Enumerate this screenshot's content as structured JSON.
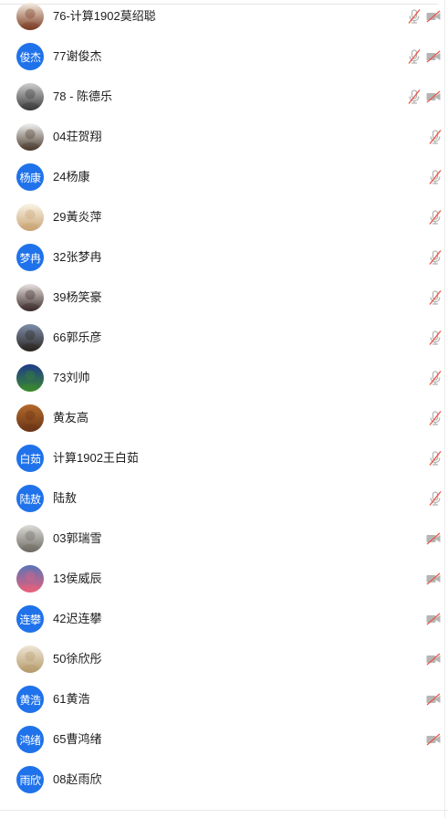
{
  "participants": [
    {
      "name": "76-计算1902莫绍聪",
      "avatar": {
        "kind": "photo",
        "colors": [
          "#f7eee3",
          "#7a3b21"
        ]
      },
      "mic": "muted",
      "camera": "off"
    },
    {
      "name": "77谢俊杰",
      "avatar": {
        "kind": "text",
        "text": "俊杰"
      },
      "mic": "muted",
      "camera": "off"
    },
    {
      "name": "78 - 陈德乐",
      "avatar": {
        "kind": "photo",
        "colors": [
          "#cfcfcf",
          "#3a3a3a"
        ]
      },
      "mic": "muted",
      "camera": "off"
    },
    {
      "name": "04荘贺翔",
      "avatar": {
        "kind": "photo",
        "colors": [
          "#f4f4f4",
          "#4b3a2c"
        ]
      },
      "mic": "muted",
      "camera": "none"
    },
    {
      "name": "24杨康",
      "avatar": {
        "kind": "text",
        "text": "杨康"
      },
      "mic": "muted",
      "camera": "none"
    },
    {
      "name": "29黃炎萍",
      "avatar": {
        "kind": "photo",
        "colors": [
          "#fbf4e6",
          "#c8a373"
        ]
      },
      "mic": "muted",
      "camera": "none"
    },
    {
      "name": "32张梦冉",
      "avatar": {
        "kind": "text",
        "text": "梦冉"
      },
      "mic": "muted",
      "camera": "none"
    },
    {
      "name": "39杨笑豪",
      "avatar": {
        "kind": "photo",
        "colors": [
          "#e9e2e0",
          "#3b2c2a"
        ]
      },
      "mic": "muted",
      "camera": "none"
    },
    {
      "name": "66郭乐彦",
      "avatar": {
        "kind": "photo",
        "colors": [
          "#7e8fab",
          "#2b2520"
        ]
      },
      "mic": "muted",
      "camera": "none"
    },
    {
      "name": "73刘帅",
      "avatar": {
        "kind": "photo",
        "colors": [
          "#1e3b8a",
          "#3b8a2d"
        ]
      },
      "mic": "muted",
      "camera": "none"
    },
    {
      "name": "黄友高",
      "avatar": {
        "kind": "photo",
        "colors": [
          "#b36a2b",
          "#6a3516"
        ]
      },
      "mic": "muted",
      "camera": "none"
    },
    {
      "name": "计算1902王白茹",
      "avatar": {
        "kind": "text",
        "text": "白茹"
      },
      "mic": "muted",
      "camera": "none"
    },
    {
      "name": "陆敖",
      "avatar": {
        "kind": "text",
        "text": "陆敖"
      },
      "mic": "muted",
      "camera": "none"
    },
    {
      "name": "03郭瑞雪",
      "avatar": {
        "kind": "photo",
        "colors": [
          "#dcdcd8",
          "#6e6a63"
        ]
      },
      "mic": "none",
      "camera": "off"
    },
    {
      "name": "13侯威辰",
      "avatar": {
        "kind": "photo",
        "colors": [
          "#5a73b8",
          "#e8607a"
        ]
      },
      "mic": "none",
      "camera": "off"
    },
    {
      "name": "42迟连攀",
      "avatar": {
        "kind": "text",
        "text": "连攀"
      },
      "mic": "none",
      "camera": "off"
    },
    {
      "name": "50徐欣彤",
      "avatar": {
        "kind": "photo",
        "colors": [
          "#efe6d6",
          "#b59a6b"
        ]
      },
      "mic": "none",
      "camera": "off"
    },
    {
      "name": "61黄浩",
      "avatar": {
        "kind": "text",
        "text": "黄浩"
      },
      "mic": "none",
      "camera": "off"
    },
    {
      "name": "65曹鸿绪",
      "avatar": {
        "kind": "text",
        "text": "鸿绪"
      },
      "mic": "none",
      "camera": "off"
    },
    {
      "name": "08赵雨欣",
      "avatar": {
        "kind": "text",
        "text": "雨欣"
      },
      "mic": "none",
      "camera": "none"
    }
  ],
  "colors": {
    "avatar_blue": "#1f72ea",
    "icon_gray": "#b5b5b5",
    "muted_slash": "#e8584b"
  },
  "icons": {
    "mic": "microphone-muted-icon",
    "camera": "video-camera-off-icon"
  }
}
